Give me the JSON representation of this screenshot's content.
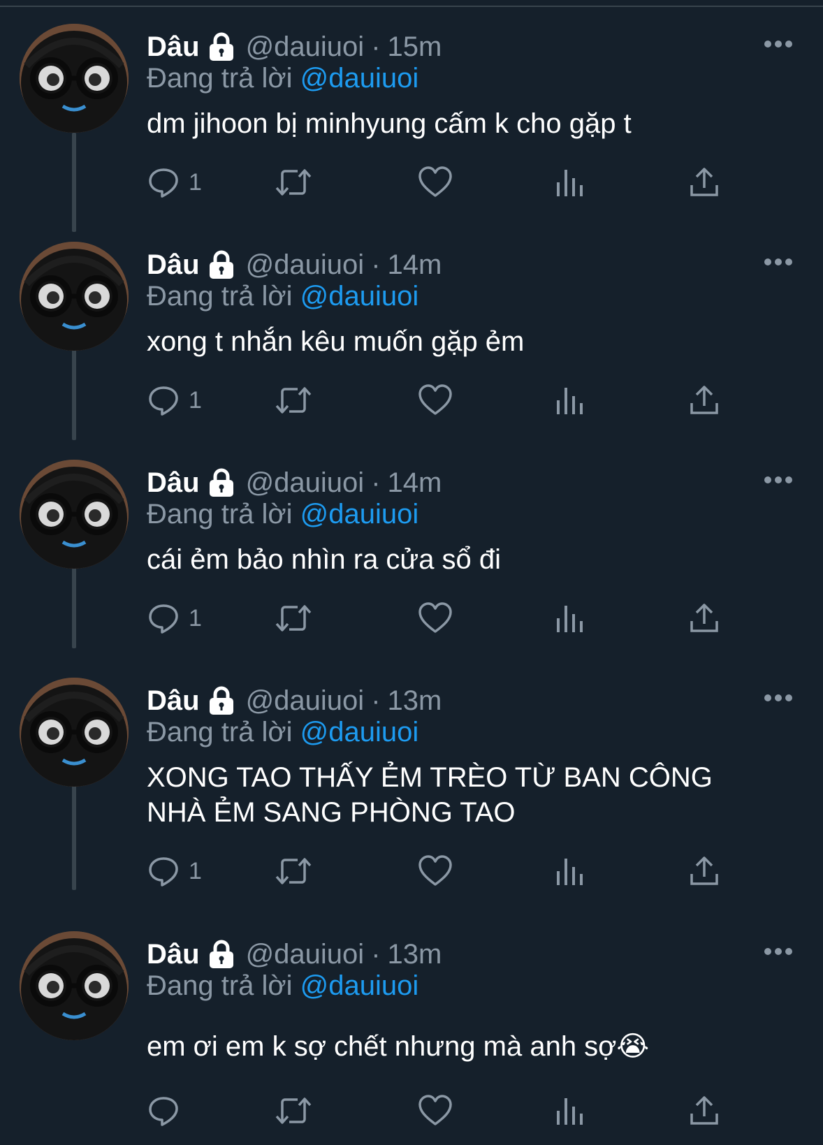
{
  "colors": {
    "background": "#15202b",
    "muted": "#8b98a5",
    "link": "#1d9bf0",
    "text": "#ffffff",
    "thread_line": "#38444d"
  },
  "tweets": [
    {
      "display_name": "Dâu",
      "handle": "@dauiuoi",
      "separator": "·",
      "time": "15m",
      "replying_prefix": "Đang trả lời",
      "replying_to": "@dauiuoi",
      "text": "dm jihoon bị minhyung cấm k cho gặp t",
      "reply_count": "1",
      "icons": [
        "lock-icon",
        "more-icon",
        "reply-icon",
        "retweet-icon",
        "like-icon",
        "views-icon",
        "share-icon"
      ]
    },
    {
      "display_name": "Dâu",
      "handle": "@dauiuoi",
      "separator": "·",
      "time": "14m",
      "replying_prefix": "Đang trả lời",
      "replying_to": "@dauiuoi",
      "text": "xong t nhắn kêu muốn gặp ẻm",
      "reply_count": "1"
    },
    {
      "display_name": "Dâu",
      "handle": "@dauiuoi",
      "separator": "·",
      "time": "14m",
      "replying_prefix": "Đang trả lời",
      "replying_to": "@dauiuoi",
      "text": "cái ẻm bảo nhìn ra cửa sổ đi",
      "reply_count": "1"
    },
    {
      "display_name": "Dâu",
      "handle": "@dauiuoi",
      "separator": "·",
      "time": "13m",
      "replying_prefix": "Đang trả lời",
      "replying_to": "@dauiuoi",
      "text": "XONG TAO THẤY ẺM TRÈO TỪ BAN CÔNG NHÀ ẺM SANG PHÒNG TAO",
      "reply_count": "1"
    },
    {
      "display_name": "Dâu",
      "handle": "@dauiuoi",
      "separator": "·",
      "time": "13m",
      "replying_prefix": "Đang trả lời",
      "replying_to": "@dauiuoi",
      "text": "em ơi em k sợ chết nhưng mà anh sợ😭",
      "reply_count": ""
    }
  ]
}
